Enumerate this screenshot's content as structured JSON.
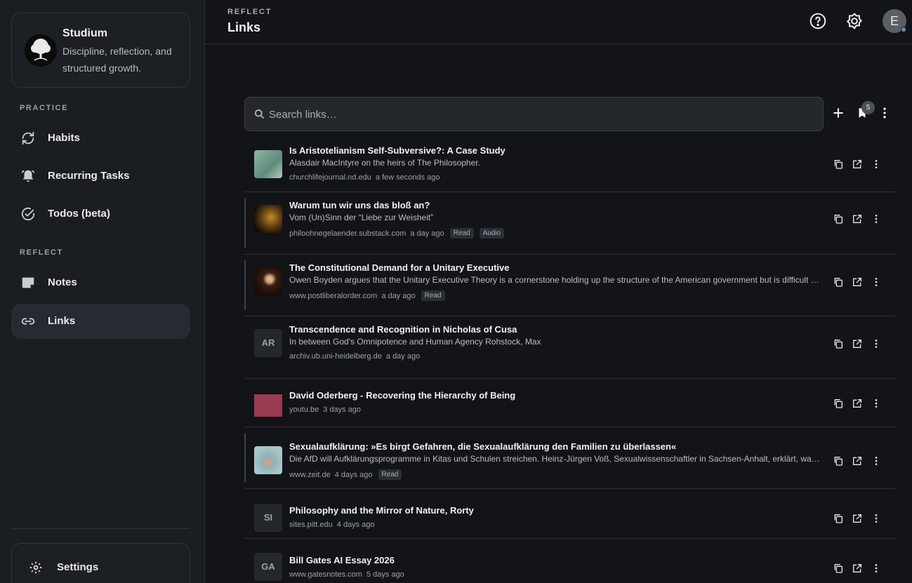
{
  "sidebar": {
    "brand": {
      "name": "Studium",
      "tagline": "Discipline, reflection, and structured growth."
    },
    "sections": [
      {
        "label": "PRACTICE",
        "items": [
          {
            "label": "Habits",
            "icon": "sync-icon"
          },
          {
            "label": "Recurring Tasks",
            "icon": "bell-alarm-icon"
          },
          {
            "label": "Todos (beta)",
            "icon": "check-circle-icon"
          }
        ]
      },
      {
        "label": "REFLECT",
        "items": [
          {
            "label": "Notes",
            "icon": "note-icon"
          },
          {
            "label": "Links",
            "icon": "link-icon",
            "active": true
          }
        ]
      }
    ],
    "settings_label": "Settings"
  },
  "header": {
    "breadcrumb": "REFLECT",
    "title": "Links",
    "avatar_initial": "E"
  },
  "toolbar": {
    "search_placeholder": "Search links…",
    "bookmark_count": "5"
  },
  "links": [
    {
      "title": "Is Aristotelianism Self-Subversive?: A Case Study",
      "description": "Alasdair MacIntyre on the heirs of The Philosopher.",
      "domain": "churchlifejournal.nd.edu",
      "ago": "a few seconds ago",
      "tags": [],
      "thumb": "image",
      "unread": false
    },
    {
      "title": "Warum tun wir uns das bloß an?",
      "description": "Vom (Un)Sinn der “Liebe zur Weisheit”",
      "domain": "philoohnegelaender.substack.com",
      "ago": "a day ago",
      "tags": [
        "Read",
        "Audio"
      ],
      "thumb": "image",
      "unread": true
    },
    {
      "title": "The Constitutional Demand for a Unitary Executive",
      "description": "Owen Boyden argues that the Unitary Executive Theory is a cornerstone holding up the structure of the American government but is difficult to defend without understanding its origins.",
      "domain": "www.postliberalorder.com",
      "ago": "a day ago",
      "tags": [
        "Read"
      ],
      "thumb": "image",
      "unread": true
    },
    {
      "title": "Transcendence and Recognition in Nicholas of Cusa",
      "description": "In between God's Omnipotence and Human Agency Rohstock, Max",
      "domain": "archiv.ub.uni-heidelberg.de",
      "ago": "a day ago",
      "tags": [],
      "thumb": "AR",
      "unread": false
    },
    {
      "title": "David Oderberg - Recovering the Hierarchy of Being",
      "description": "",
      "domain": "youtu.be",
      "ago": "3 days ago",
      "tags": [],
      "thumb": "image",
      "unread": false
    },
    {
      "title": "Sexualaufklärung: »Es birgt Gefahren, die Sexualaufklärung den Familien zu überlassen«",
      "description": "Die AfD will Aufklärungsprogramme in Kitas und Schulen streichen. Heinz-Jürgen Voß, Sexualwissenschaftler in Sachsen-Anhalt, erklärt, warum das gefährlich ist.",
      "domain": "www.zeit.de",
      "ago": "4 days ago",
      "tags": [
        "Read"
      ],
      "thumb": "image",
      "unread": true
    },
    {
      "title": "Philosophy and the Mirror of Nature, Rorty",
      "description": "",
      "domain": "sites.pitt.edu",
      "ago": "4 days ago",
      "tags": [],
      "thumb": "SI",
      "unread": false
    },
    {
      "title": "Bill Gates AI Essay 2026",
      "description": "",
      "domain": "www.gatesnotes.com",
      "ago": "5 days ago",
      "tags": [],
      "thumb": "GA",
      "unread": false
    }
  ]
}
